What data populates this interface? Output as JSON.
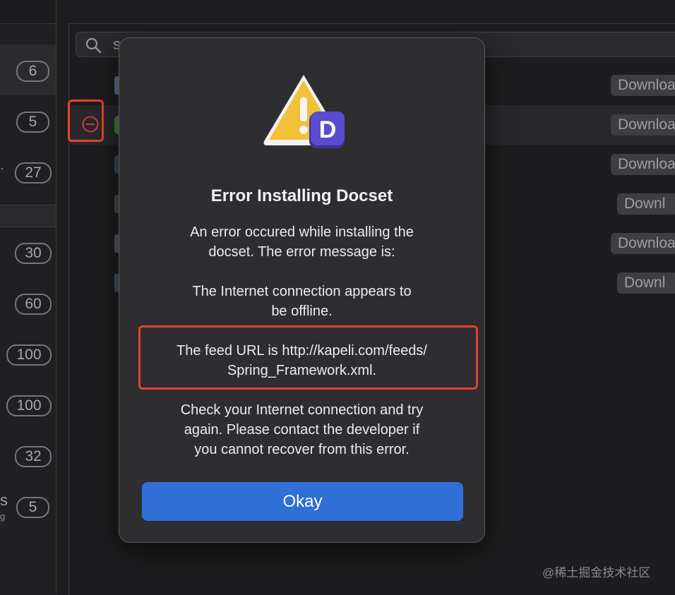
{
  "sidebar": {
    "badges": [
      "6",
      "5",
      "27",
      "30",
      "60",
      "100",
      "100",
      "32",
      "5"
    ],
    "fragments": [
      "·",
      "s",
      "g"
    ]
  },
  "search": {
    "text": "s"
  },
  "list": {
    "download_labels": [
      "Downloa",
      "Downloa",
      "Downloa",
      "Downl",
      "Downloa",
      "Downl"
    ]
  },
  "dialog": {
    "title": "Error Installing Docset",
    "message_1_line1": "An error occured while installing the",
    "message_1_line2": "docset. The error message is:",
    "message_2_line1": "The Internet connection appears to",
    "message_2_line2": "be offline.",
    "feed_line1": "The feed URL is http://kapeli.com/feeds/",
    "feed_line2": "Spring_Framework.xml.",
    "message_3_line1": "Check your Internet connection and try",
    "message_3_line2": "again. Please contact the developer if",
    "message_3_line3": "you cannot recover from this error.",
    "okay_label": "Okay"
  },
  "watermark": "@稀土掘金技术社区",
  "colors": {
    "accent": "#2f6fd6",
    "highlight": "#e2442c",
    "app_icon": "#5b4bd1",
    "warning": "#f2c13a"
  }
}
